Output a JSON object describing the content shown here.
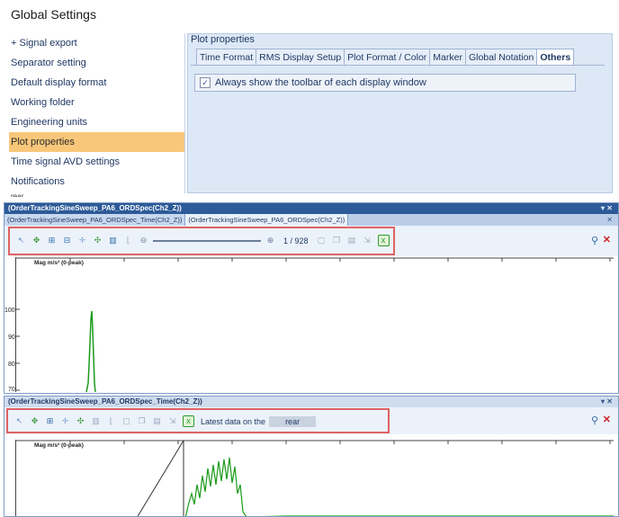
{
  "window_title": "Global Settings",
  "left_items": [
    {
      "label": "+ Signal export"
    },
    {
      "label": "Separator setting"
    },
    {
      "label": "Default display format"
    },
    {
      "label": "Working folder"
    },
    {
      "label": "Engineering units"
    },
    {
      "label": "Plot properties",
      "selected": true
    },
    {
      "label": "Time signal AVD settings"
    },
    {
      "label": "Notifications"
    }
  ],
  "cut_item_label": "rear",
  "props": {
    "title": "Plot properties",
    "tabs": [
      "Time Format",
      "RMS Display Setup",
      "Plot Format / Color",
      "Marker",
      "Global Notation",
      "Others"
    ],
    "active_tab": "Others",
    "checkbox_label": "Always show the toolbar of each display window",
    "checkbox_checked": true
  },
  "window1": {
    "title": "(OrderTrackingSineSweep_PA6_ORDSpec(Ch2_Z))",
    "controls": "▾ ✕",
    "subtabs": [
      "(OrderTrackingSineSweep_PA6_ORDSpec_Time(Ch2_Z))",
      "(OrderTrackingSineSweep_PA6_ORDSpec(Ch2_Z))"
    ],
    "subtab_close": "✕",
    "page_counter": "1 / 928",
    "axis_label": "Mag m/s² (0-peak)",
    "yticks": [
      "100",
      "90",
      "80",
      "70"
    ]
  },
  "window2": {
    "title": "(OrderTrackingSineSweep_PA6_ORDSpec_Time(Ch2_Z))",
    "controls": "▾ ✕",
    "latest_label": "Latest data on the",
    "latest_value": "rear",
    "axis_label": "Mag m/s² (0-peak)"
  },
  "colors": {
    "header_blue": "#2d5a98",
    "selection_orange": "#f9c77a",
    "highlight_red": "#e06262",
    "trace_green": "#1a9b1a"
  },
  "icons": [
    "cursor-icon",
    "move-icon",
    "zoom-x-icon",
    "zoom-y-icon",
    "zoom-box-icon",
    "autoscale-icon",
    "bar-chart-icon",
    "line-chart-icon",
    "page-icon",
    "copy-icon",
    "print-icon",
    "export-icon",
    "excel-icon",
    "pin-icon",
    "close-icon"
  ]
}
